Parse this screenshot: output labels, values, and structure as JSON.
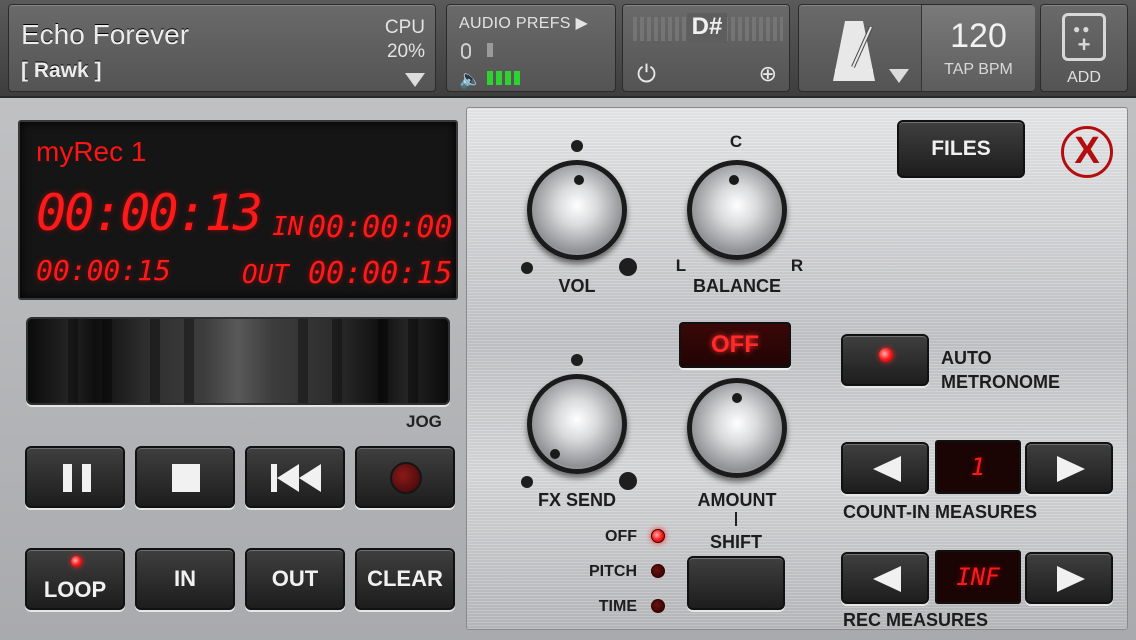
{
  "topbar": {
    "song_title": "Echo Forever",
    "song_sub": "[ Rawk ]",
    "cpu_label": "CPU",
    "cpu_value": "20%",
    "audio_prefs_label": "AUDIO PREFS ▶",
    "tuner_note": "D#",
    "bpm_value": "120",
    "bpm_label": "TAP BPM",
    "add_label": "ADD",
    "input_level_bars": 4
  },
  "display": {
    "rec_name": "myRec 1",
    "time_main": "00:00:13",
    "in_label": "IN",
    "in_time": "00:00:00",
    "length_time": "00:00:15",
    "out_label": "OUT",
    "out_time": "00:00:15"
  },
  "jog": {
    "label": "JOG"
  },
  "bottom_buttons": {
    "loop": "LOOP",
    "in": "IN",
    "out": "OUT",
    "clear": "CLEAR"
  },
  "knobs": {
    "vol": "VOL",
    "balance": "BALANCE",
    "balance_top": "C",
    "balance_left": "L",
    "balance_right": "R",
    "fx_send": "FX SEND",
    "amount": "AMOUNT"
  },
  "controls": {
    "files_label": "FILES",
    "close_glyph": "X",
    "fx_toggle": "OFF",
    "auto_metronome": [
      "AUTO",
      "METRONOME"
    ],
    "count_in_value": "1",
    "count_in_label": "COUNT-IN MEASURES",
    "rec_measures_value": "INF",
    "rec_measures_label": "REC MEASURES",
    "shift_label": "SHIFT",
    "mode_options": [
      "OFF",
      "PITCH",
      "TIME"
    ],
    "mode_selected": "OFF"
  },
  "colors": {
    "led_red": "#ff1a1a",
    "level_green": "#2fd32f",
    "close_red": "#b30d0d"
  }
}
